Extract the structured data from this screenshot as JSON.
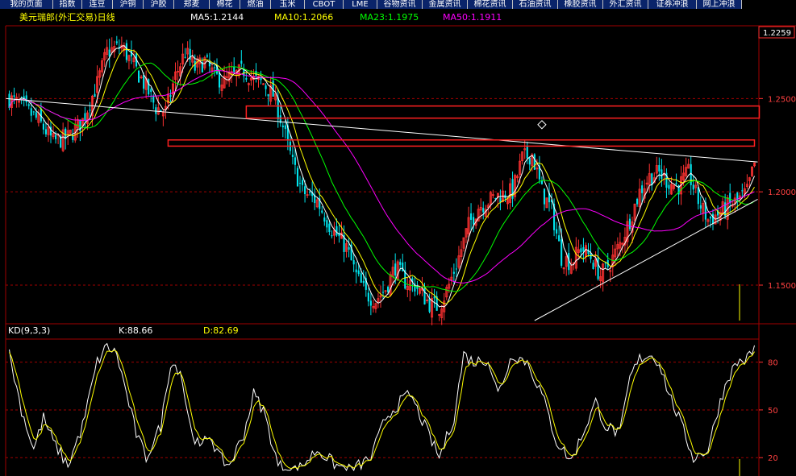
{
  "tabs": [
    "我的页面",
    "指数",
    "连豆",
    "沪铜",
    "沪胶",
    "郑麦",
    "棉花",
    "燃油",
    "玉米",
    "CBOT",
    "LME",
    "谷物资讯",
    "金属资讯",
    "棉花资讯",
    "石油资讯",
    "橡胶资讯",
    "外汇资讯",
    "证券冲浪",
    "网上冲浪"
  ],
  "header": {
    "title": "美元瑞郎(外汇交易)日线",
    "ma5": "MA5:1.2144",
    "ma10": "MA10:1.2066",
    "ma23": "MA23:1.1975",
    "ma50": "MA50:1.1911"
  },
  "kd_header": {
    "name": "KD(9,3,3)",
    "k": "K:88.66",
    "d": "D:82.69"
  },
  "price_label": "1.2259",
  "colors": {
    "background": "#000000",
    "up": "#ff3232",
    "down": "#00e5ee",
    "ma5": "#ffffff",
    "ma10": "#ffff00",
    "ma23": "#00ff00",
    "ma50": "#ff00ff",
    "grid": "#a00000",
    "title": "#ffff00",
    "tab_bg": "#0a246a"
  },
  "chart_data": [
    {
      "type": "candlestick",
      "title": "美元瑞郎(外汇交易)日线",
      "yticks": [
        "1.2500",
        "1.2000",
        "1.1500"
      ],
      "ylim": [
        1.131,
        1.289
      ],
      "y_grid": [
        1.25,
        1.2,
        1.15
      ],
      "keypoints": [
        [
          0,
          1.25
        ],
        [
          6,
          1.245
        ],
        [
          12,
          1.238
        ],
        [
          18,
          1.227
        ],
        [
          24,
          1.229
        ],
        [
          30,
          1.238
        ],
        [
          36,
          1.258
        ],
        [
          40,
          1.275
        ],
        [
          46,
          1.278
        ],
        [
          52,
          1.265
        ],
        [
          56,
          1.256
        ],
        [
          60,
          1.245
        ],
        [
          64,
          1.243
        ],
        [
          68,
          1.262
        ],
        [
          72,
          1.275
        ],
        [
          76,
          1.266
        ],
        [
          80,
          1.27
        ],
        [
          84,
          1.262
        ],
        [
          88,
          1.259
        ],
        [
          92,
          1.262
        ],
        [
          96,
          1.265
        ],
        [
          100,
          1.26
        ],
        [
          104,
          1.258
        ],
        [
          108,
          1.252
        ],
        [
          112,
          1.235
        ],
        [
          116,
          1.215
        ],
        [
          120,
          1.2
        ],
        [
          126,
          1.195
        ],
        [
          132,
          1.18
        ],
        [
          138,
          1.17
        ],
        [
          142,
          1.155
        ],
        [
          146,
          1.145
        ],
        [
          150,
          1.142
        ],
        [
          154,
          1.148
        ],
        [
          158,
          1.16
        ],
        [
          162,
          1.152
        ],
        [
          166,
          1.15
        ],
        [
          172,
          1.14
        ],
        [
          176,
          1.138
        ],
        [
          180,
          1.15
        ],
        [
          184,
          1.165
        ],
        [
          188,
          1.182
        ],
        [
          192,
          1.192
        ],
        [
          196,
          1.195
        ],
        [
          200,
          1.198
        ],
        [
          206,
          1.2
        ],
        [
          210,
          1.218
        ],
        [
          214,
          1.22
        ],
        [
          218,
          1.2
        ],
        [
          222,
          1.19
        ],
        [
          226,
          1.165
        ],
        [
          230,
          1.162
        ],
        [
          234,
          1.17
        ],
        [
          238,
          1.165
        ],
        [
          242,
          1.155
        ],
        [
          246,
          1.162
        ],
        [
          250,
          1.172
        ],
        [
          254,
          1.185
        ],
        [
          258,
          1.2
        ],
        [
          262,
          1.208
        ],
        [
          266,
          1.21
        ],
        [
          270,
          1.205
        ],
        [
          274,
          1.203
        ],
        [
          278,
          1.21
        ],
        [
          282,
          1.195
        ],
        [
          286,
          1.185
        ],
        [
          290,
          1.188
        ],
        [
          294,
          1.192
        ],
        [
          298,
          1.195
        ],
        [
          302,
          1.2
        ],
        [
          305,
          1.215
        ]
      ],
      "ma_labels": [
        "MA5:1.2144",
        "MA10:1.2066",
        "MA23:1.1975",
        "MA50:1.1911"
      ],
      "annotations": {
        "resistance_line": {
          "from": [
            0,
            1.25
          ],
          "to": [
            305,
            1.216
          ]
        },
        "support_line": {
          "from": [
            215,
            1.131
          ],
          "to": [
            305,
            1.196
          ]
        },
        "top_box": {
          "x": [
            65,
            305
          ],
          "y_range": [
            1.2245,
            1.2278
          ]
        },
        "mid_box": {
          "x": [
            97,
            305
          ],
          "y_range": [
            1.2395,
            1.246
          ]
        },
        "diamond": {
          "x": 218,
          "y": 1.236
        }
      }
    },
    {
      "type": "line",
      "title": "KD(9,3,3)",
      "yticks": [
        "80",
        "50",
        "20"
      ],
      "ylim": [
        10,
        95
      ],
      "series": [
        {
          "name": "K",
          "value_label": "K:88.66"
        },
        {
          "name": "D",
          "value_label": "D:82.69"
        }
      ],
      "keypoints_k": [
        [
          0,
          85
        ],
        [
          5,
          50
        ],
        [
          10,
          25
        ],
        [
          14,
          45
        ],
        [
          18,
          30
        ],
        [
          24,
          15
        ],
        [
          30,
          40
        ],
        [
          36,
          80
        ],
        [
          40,
          90
        ],
        [
          44,
          85
        ],
        [
          48,
          60
        ],
        [
          52,
          35
        ],
        [
          56,
          20
        ],
        [
          62,
          40
        ],
        [
          66,
          80
        ],
        [
          70,
          75
        ],
        [
          74,
          40
        ],
        [
          78,
          25
        ],
        [
          82,
          35
        ],
        [
          86,
          20
        ],
        [
          90,
          15
        ],
        [
          96,
          35
        ],
        [
          100,
          60
        ],
        [
          104,
          50
        ],
        [
          110,
          15
        ],
        [
          118,
          12
        ],
        [
          126,
          25
        ],
        [
          134,
          15
        ],
        [
          140,
          12
        ],
        [
          148,
          20
        ],
        [
          154,
          45
        ],
        [
          160,
          55
        ],
        [
          164,
          60
        ],
        [
          170,
          40
        ],
        [
          176,
          20
        ],
        [
          182,
          45
        ],
        [
          186,
          85
        ],
        [
          190,
          80
        ],
        [
          196,
          82
        ],
        [
          200,
          60
        ],
        [
          206,
          85
        ],
        [
          212,
          80
        ],
        [
          218,
          60
        ],
        [
          224,
          30
        ],
        [
          230,
          18
        ],
        [
          236,
          40
        ],
        [
          240,
          55
        ],
        [
          244,
          40
        ],
        [
          250,
          35
        ],
        [
          254,
          70
        ],
        [
          258,
          82
        ],
        [
          262,
          85
        ],
        [
          266,
          80
        ],
        [
          270,
          60
        ],
        [
          274,
          45
        ],
        [
          280,
          20
        ],
        [
          286,
          25
        ],
        [
          290,
          50
        ],
        [
          294,
          70
        ],
        [
          298,
          80
        ],
        [
          302,
          82
        ],
        [
          305,
          88.66
        ]
      ]
    }
  ]
}
